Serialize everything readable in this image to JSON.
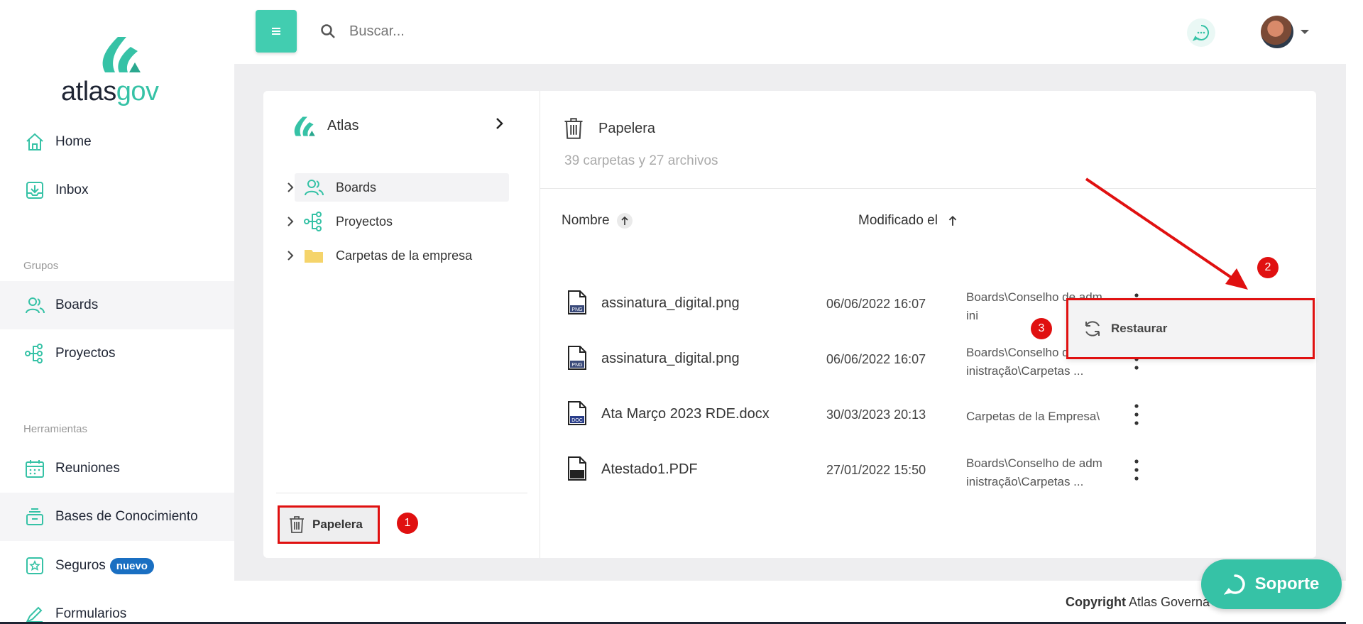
{
  "sidebar": {
    "logo": {
      "atlas": "atlas",
      "gov": "gov"
    },
    "items": [
      {
        "label": "Home",
        "icon": "home-icon"
      },
      {
        "label": "Inbox",
        "icon": "inbox-icon"
      }
    ],
    "sections": {
      "grupos": "Grupos",
      "herramientas": "Herramientas"
    },
    "groups": [
      {
        "label": "Boards",
        "icon": "users-icon"
      },
      {
        "label": "Proyectos",
        "icon": "hierarchy-icon"
      }
    ],
    "tools": [
      {
        "label": "Reuniones",
        "icon": "calendar-icon"
      },
      {
        "label": "Bases de Conocimiento",
        "icon": "stack-icon"
      },
      {
        "label": "Seguros",
        "icon": "safe-icon",
        "badge": "nuevo"
      },
      {
        "label": "Formularios",
        "icon": "pen-icon"
      }
    ]
  },
  "topbar": {
    "search_placeholder": "Buscar..."
  },
  "tree": {
    "root": "Atlas",
    "items": [
      {
        "label": "Boards"
      },
      {
        "label": "Proyectos"
      },
      {
        "label": "Carpetas de la empresa"
      }
    ],
    "trash_label": "Papelera"
  },
  "content": {
    "title": "Papelera",
    "subtitle": "39 carpetas y 27 archivos",
    "columns": {
      "name": "Nombre",
      "modified": "Modificado el"
    },
    "rows": [
      {
        "name": "assinatura_digital.png",
        "type": "PNG",
        "date": "06/06/2022 16:07",
        "path1": "Boards\\Conselho de adm",
        "path2": "ini"
      },
      {
        "name": "assinatura_digital.png",
        "type": "PNG",
        "date": "06/06/2022 16:07",
        "path1": "Boards\\Conselho de adm",
        "path2": "inistração\\Carpetas ..."
      },
      {
        "name": "Ata Março 2023 RDE.docx",
        "type": "DOC",
        "date": "30/03/2023 20:13",
        "path1": "Carpetas de la Empresa\\",
        "path2": ""
      },
      {
        "name": "Atestado1.PDF",
        "type": "PDF",
        "date": "27/01/2022 15:50",
        "path1": "Boards\\Conselho de adm",
        "path2": "inistração\\Carpetas ..."
      }
    ]
  },
  "context_menu": {
    "restore_label": "Restaurar"
  },
  "annotations": {
    "one": "1",
    "two": "2",
    "three": "3"
  },
  "footer": {
    "copyright": "Copyright",
    "company": "Atlas Governa"
  },
  "support": {
    "label": "Soporte"
  },
  "colors": {
    "accent": "#36c2a6",
    "annotation": "#e01010",
    "badge": "#1a6fc2"
  }
}
